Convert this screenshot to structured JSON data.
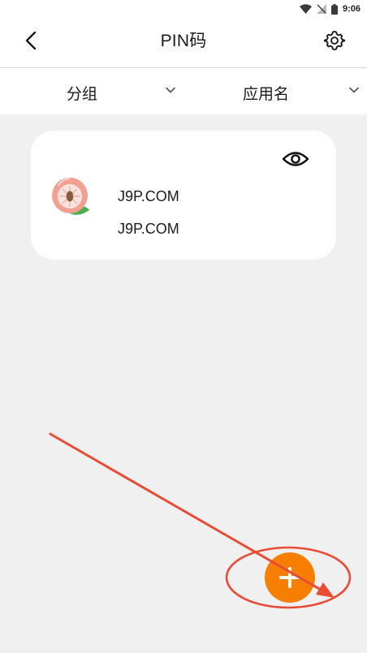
{
  "status_bar": {
    "time": "9:06",
    "icons": [
      "wifi-icon",
      "no-signal-icon",
      "battery-icon"
    ]
  },
  "header": {
    "title": "PIN码",
    "back_icon": "back-chevron-icon",
    "settings_icon": "gear-icon"
  },
  "filters": [
    {
      "label": "分组",
      "icon": "chevron-down-icon"
    },
    {
      "label": "应用名",
      "icon": "chevron-down-icon"
    }
  ],
  "entry": {
    "icon": "peach-app-icon",
    "visibility_icon": "eye-icon",
    "line1": "J9P.COM",
    "line2": "J9P.COM"
  },
  "fab": {
    "icon": "plus-icon"
  },
  "colors": {
    "background": "#f1f0f1",
    "accent": "#f77f00",
    "annotation": "#e84c34"
  }
}
